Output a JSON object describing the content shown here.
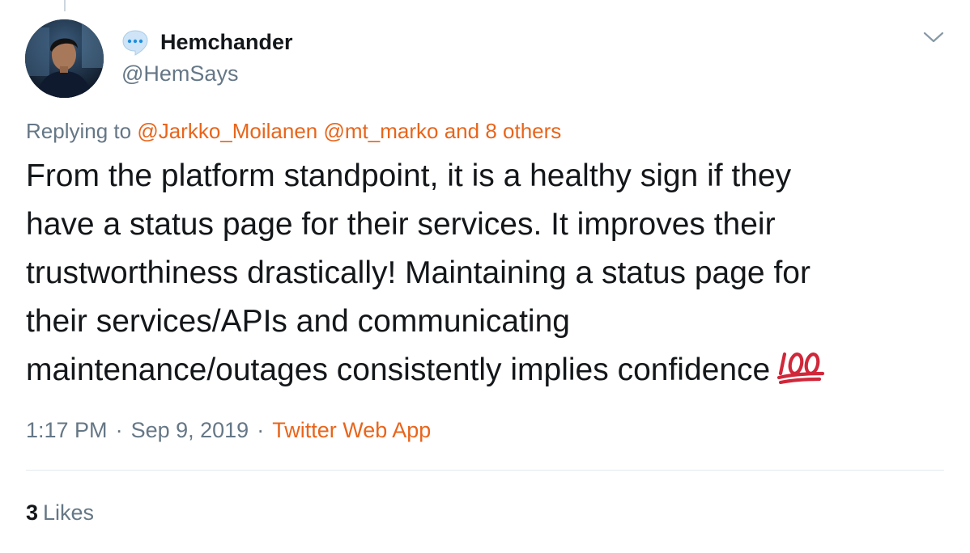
{
  "user": {
    "display_name": "Hemchander",
    "handle": "@HemSays",
    "avatar_icon": "profile-photo",
    "badge_icon": "speech-bubble-icon"
  },
  "reply": {
    "prefix": "Replying to",
    "mention_1": "@Jarkko_Moilanen",
    "mention_2": "@mt_marko",
    "others": "and 8 others"
  },
  "tweet": {
    "lines": [
      "From the platform standpoint, it is a healthy sign if they",
      "have a status page for their services. It improves their",
      "trustworthiness drastically! Maintaining a status page for",
      "their services/APIs and communicating",
      "maintenance/outages consistently implies confidence"
    ],
    "emoji_icon": "hundred-points-emoji"
  },
  "meta": {
    "time": "1:17 PM",
    "separator": "·",
    "date": "Sep 9, 2019",
    "source": "Twitter Web App"
  },
  "stats": {
    "likes_count": "3",
    "likes_label": "Likes"
  },
  "colors": {
    "link": "#e8651b",
    "secondary_text": "#657786",
    "primary_text": "#14171a",
    "divider": "#e1e8ed",
    "emoji_red": "#d0273a"
  }
}
